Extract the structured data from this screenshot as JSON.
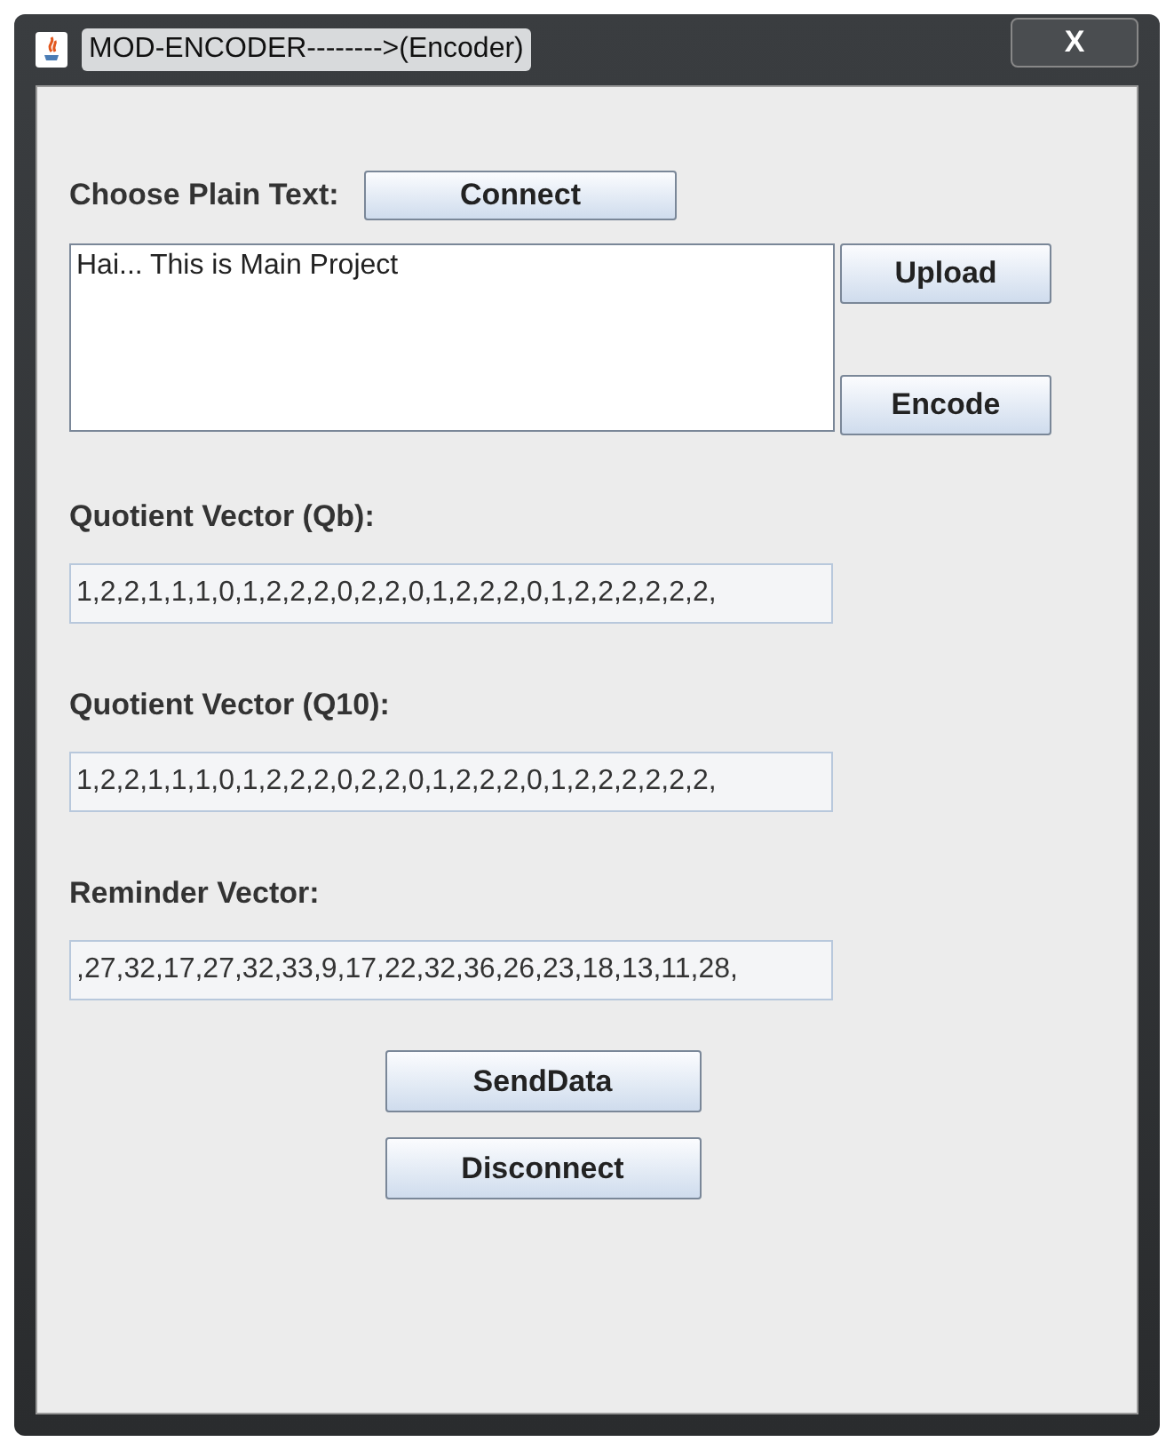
{
  "window": {
    "title": "MOD-ENCODER-------->(Encoder)",
    "close": "X"
  },
  "plain_text": {
    "label": "Choose Plain Text:",
    "connect": "Connect",
    "value": "Hai... This is Main Project",
    "upload": "Upload",
    "encode": "Encode"
  },
  "fields": [
    {
      "label": "Quotient Vector (Qb):",
      "value": "1,2,2,1,1,1,0,1,2,2,2,0,2,2,0,1,2,2,2,0,1,2,2,2,2,2,2,"
    },
    {
      "label": "Quotient Vector (Q10):",
      "value": "1,2,2,1,1,1,0,1,2,2,2,0,2,2,0,1,2,2,2,0,1,2,2,2,2,2,2,"
    },
    {
      "label": "Reminder Vector:",
      "value": ",27,32,17,27,32,33,9,17,22,32,36,26,23,18,13,11,28,"
    }
  ],
  "buttons": [
    "SendData",
    "Disconnect"
  ]
}
